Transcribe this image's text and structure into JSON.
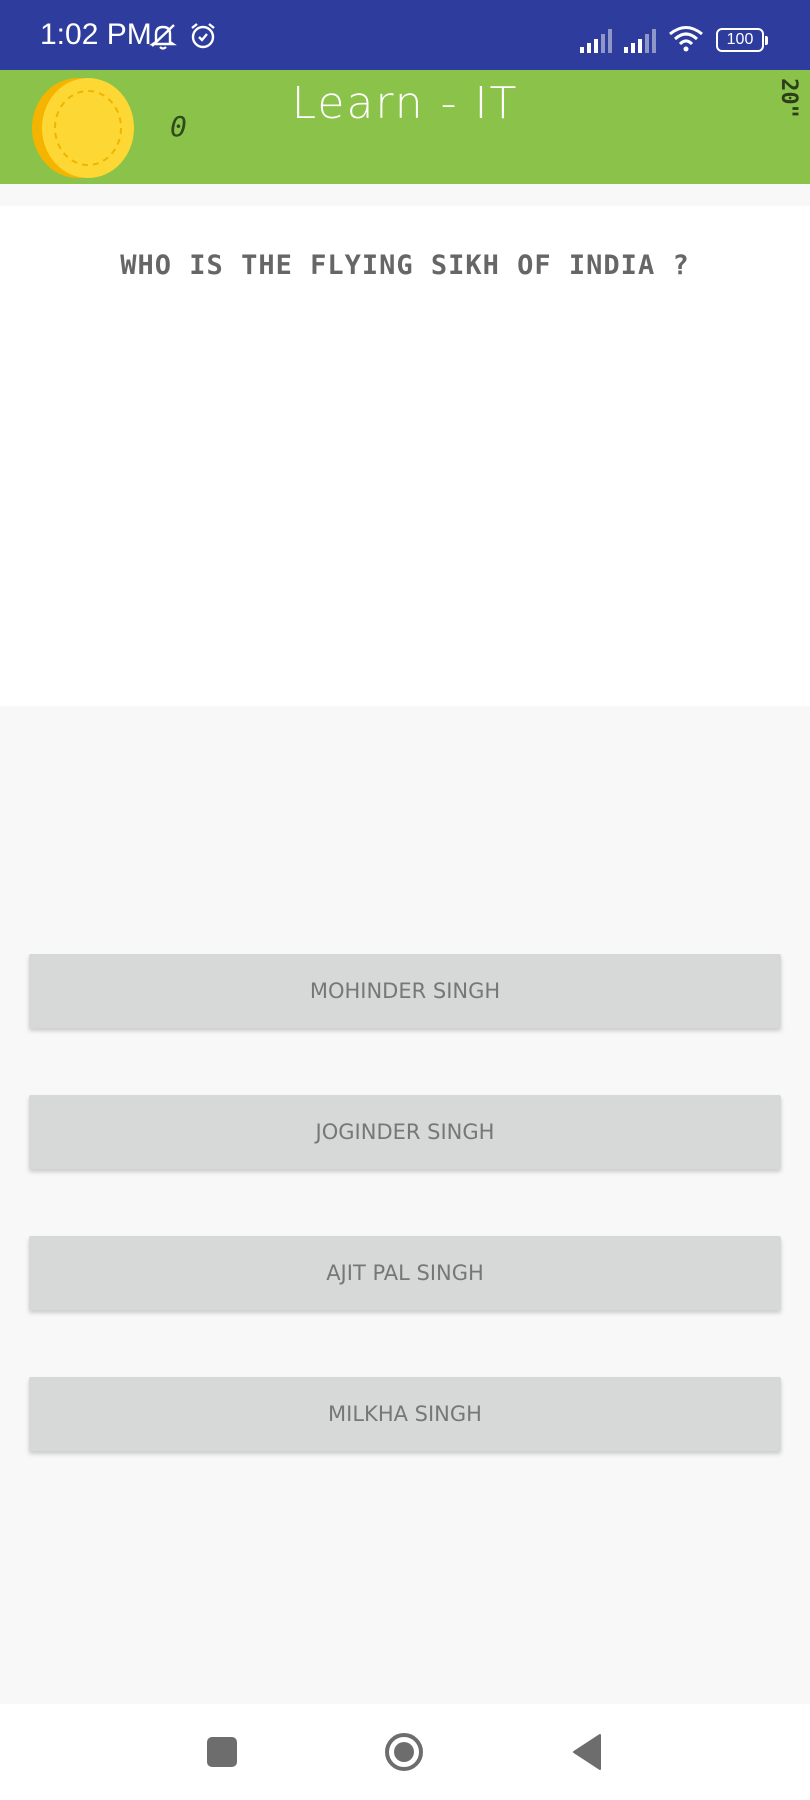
{
  "status_bar": {
    "time": "1:02 PM",
    "icons_left": [
      "notifications-muted-icon",
      "alarm-icon"
    ],
    "icons_right": [
      "signal-icon",
      "signal-icon",
      "wifi-icon",
      "battery-icon"
    ],
    "battery": "100"
  },
  "header": {
    "coin_icon": "coin-icon",
    "coin_count": "0",
    "title": "Learn - IT",
    "timer": "20\""
  },
  "question": {
    "text": "WHO IS THE FLYING SIKH OF INDIA ?"
  },
  "answers": [
    {
      "label": "MOHINDER SINGH"
    },
    {
      "label": "JOGINDER SINGH"
    },
    {
      "label": "AJIT PAL SINGH"
    },
    {
      "label": "MILKHA SINGH"
    }
  ],
  "nav": {
    "icons": [
      "recents-icon",
      "home-icon",
      "back-icon"
    ]
  },
  "colors": {
    "status_bar": "#2e3c9e",
    "header": "#8bc34a",
    "answer_bg": "#d7d8d8",
    "coin": "#fdd835"
  }
}
